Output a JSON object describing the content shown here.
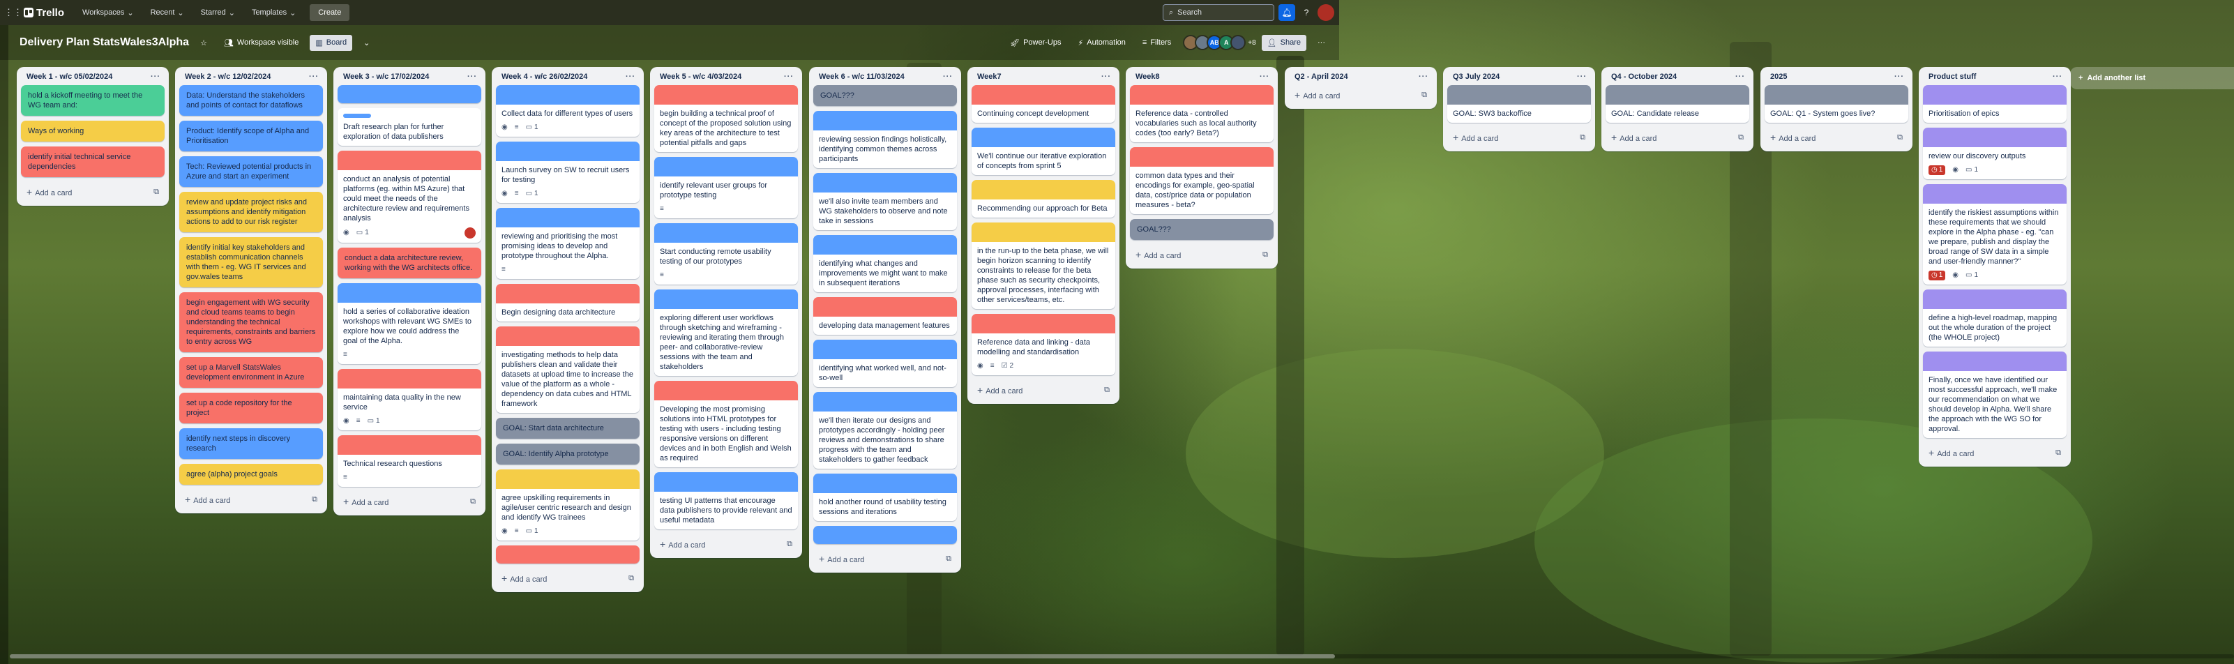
{
  "colors": {
    "red": "#f87168",
    "yellow": "#f5cd47",
    "green": "#4bce97",
    "blue": "#579dff",
    "gray": "#8590a2",
    "purple": "#9f8fef",
    "lightblue": "#cce0ff"
  },
  "topnav": {
    "logo": "Trello",
    "workspaces": "Workspaces",
    "recent": "Recent",
    "starred": "Starred",
    "templates": "Templates",
    "create": "Create",
    "search_placeholder": "Search"
  },
  "board": {
    "title": "Delivery Plan StatsWales3Alpha",
    "visibility": "Workspace visible",
    "view": "Board",
    "powerups": "Power-Ups",
    "automation": "Automation",
    "filters": "Filters",
    "member_count": "+8",
    "share": "Share",
    "avatars": [
      "AB",
      "A"
    ]
  },
  "add_card": "Add a card",
  "add_list": "Add another list",
  "lists": [
    {
      "title": "Week 1 - w/c 05/02/2024",
      "cards": [
        {
          "color": "green",
          "text": "hold a kickoff meeting to meet the WG team and:"
        },
        {
          "color": "yellow",
          "text": "Ways of working"
        },
        {
          "color": "red",
          "text": "identify initial technical service dependencies"
        }
      ]
    },
    {
      "title": "Week 2 - w/c 12/02/2024",
      "cards": [
        {
          "color": "blue",
          "text": "Data: Understand the stakeholders and points of contact for dataflows"
        },
        {
          "color": "blue",
          "text": "Product: Identify scope of Alpha and Prioritisation"
        },
        {
          "color": "blue",
          "text": "Tech: Reviewed potential products in Azure and start an experiment"
        },
        {
          "color": "yellow",
          "text": "review and update project risks and assumptions and identify mitigation actions to add to our risk register"
        },
        {
          "color": "yellow",
          "text": "identify initial key stakeholders and establish communication channels with them - eg. WG IT services and gov.wales teams"
        },
        {
          "color": "red",
          "text": "begin engagement with WG security and cloud teams teams to begin understanding the technical requirements, constraints and barriers to entry across WG"
        },
        {
          "color": "red",
          "text": "set up a Marvell StatsWales development environment in Azure"
        },
        {
          "color": "red",
          "text": "set up a code repository for the project"
        },
        {
          "color": "blue",
          "text": "identify next steps in discovery research"
        },
        {
          "color": "yellow",
          "text": "agree (alpha) project goals"
        }
      ]
    },
    {
      "title": "Week 3 - w/c 17/02/2024",
      "cards": [
        {
          "cover": "blue",
          "text": ""
        },
        {
          "label": "blue",
          "text": "Draft research plan for further exploration of data publishers"
        },
        {
          "cover": "red",
          "text": "conduct an analysis of potential platforms (eg. within MS Azure) that could meet the needs of the architecture review and requirements analysis",
          "watch": true,
          "comments": "1",
          "avatar": true
        },
        {
          "color": "red",
          "text": "conduct a data architecture review, working with the WG architects office."
        },
        {
          "cover": "blue",
          "text": "hold a series of collaborative ideation workshops with relevant WG SMEs to explore how we could address the goal of the Alpha.",
          "desc": true
        },
        {
          "cover": "red",
          "text": "maintaining data quality in the new service",
          "watch": true,
          "desc": true,
          "comments": "1"
        },
        {
          "cover": "red",
          "text": "Technical research questions",
          "desc": true
        }
      ]
    },
    {
      "title": "Week 4 - w/c 26/02/2024",
      "cards": [
        {
          "cover": "blue",
          "text": "Collect data for different types of users",
          "watch": true,
          "desc": true,
          "comments": "1"
        },
        {
          "cover": "blue",
          "text": "Launch survey on SW to recruit users for testing",
          "watch": true,
          "desc": true,
          "comments": "1"
        },
        {
          "cover": "blue",
          "text": "reviewing and prioritising the most promising ideas to develop and prototype throughout the Alpha.",
          "desc": true
        },
        {
          "cover": "red",
          "text": "Begin designing data architecture"
        },
        {
          "cover": "red",
          "text": "investigating methods to help data publishers clean and validate their datasets at upload time to increase the value of the platform as a whole - dependency on data cubes and HTML framework"
        },
        {
          "color": "gray",
          "text": "GOAL: Start data architecture"
        },
        {
          "color": "gray",
          "text": "GOAL: Identify Alpha prototype"
        },
        {
          "cover": "yellow",
          "text": "agree upskilling requirements in agile/user centric research and design and identify WG trainees",
          "watch": true,
          "desc": true,
          "comments": "1"
        },
        {
          "cover": "red",
          "text": ""
        }
      ]
    },
    {
      "title": "Week 5 - w/c 4/03/2024",
      "cards": [
        {
          "cover": "red",
          "text": "begin building a technical proof of concept of the proposed solution using key areas of the architecture to test potential pitfalls and gaps"
        },
        {
          "cover": "blue",
          "text": "identify relevant user groups for prototype testing",
          "desc": true
        },
        {
          "cover": "blue",
          "text": "Start conducting remote usability testing of our prototypes",
          "desc": true
        },
        {
          "cover": "blue",
          "text": "exploring different user workflows through sketching and wireframing - reviewing and iterating them through peer- and collaborative-review sessions with the team and stakeholders"
        },
        {
          "cover": "red",
          "text": "Developing the most promising solutions into HTML prototypes for testing with users - including testing responsive versions on different devices and in both English and Welsh as required"
        },
        {
          "cover": "blue",
          "text": "testing UI patterns that encourage data publishers to provide relevant and useful metadata"
        }
      ]
    },
    {
      "title": "Week 6 - w/c 11/03/2024",
      "cards": [
        {
          "color": "gray",
          "text": "GOAL???"
        },
        {
          "cover": "blue",
          "text": "reviewing session findings holistically, identifying common themes across participants"
        },
        {
          "cover": "blue",
          "text": "we'll also invite team members and WG stakeholders to observe and note take in sessions"
        },
        {
          "cover": "blue",
          "text": "identifying what changes and improvements we might want to make in subsequent iterations"
        },
        {
          "cover": "red",
          "text": "developing data management features"
        },
        {
          "cover": "blue",
          "text": "identifying what worked well, and not-so-well"
        },
        {
          "cover": "blue",
          "text": "we'll then iterate our designs and prototypes accordingly - holding peer reviews and demonstrations to share progress with the team and stakeholders to gather feedback"
        },
        {
          "cover": "blue",
          "text": "hold another round of usability testing sessions and iterations"
        },
        {
          "cover": "blue",
          "text": ""
        }
      ]
    },
    {
      "title": "Week7",
      "cards": [
        {
          "cover": "red",
          "text": "Continuing concept development"
        },
        {
          "cover": "blue",
          "text": "We'll continue our iterative exploration of concepts from sprint 5"
        },
        {
          "cover": "yellow",
          "text": "Recommending our approach for Beta"
        },
        {
          "cover": "yellow",
          "text": "in the run-up to the beta phase, we will begin horizon scanning to identify constraints to release for the beta phase such as security checkpoints, approval processes, interfacing with other services/teams, etc."
        },
        {
          "cover": "red",
          "text": "Reference data and linking - data modelling and standardisation",
          "watch": true,
          "desc": true,
          "checklist": "2"
        }
      ]
    },
    {
      "title": "Week8",
      "cards": [
        {
          "cover": "red",
          "text": "Reference data - controlled vocabularies such as local authority codes (too early? Beta?)"
        },
        {
          "cover": "red",
          "text": "common data types and their encodings for example, geo-spatial data, cost/price data or population measures - beta?"
        },
        {
          "color": "gray",
          "text": "GOAL???"
        }
      ]
    },
    {
      "title": "Q2 - April 2024",
      "cards": []
    },
    {
      "title": "Q3 July 2024",
      "cards": [
        {
          "cover": "gray",
          "text": "GOAL: SW3 backoffice"
        }
      ]
    },
    {
      "title": "Q4 - October 2024",
      "cards": [
        {
          "cover": "gray",
          "text": "GOAL: Candidate release"
        }
      ]
    },
    {
      "title": "2025",
      "cards": [
        {
          "cover": "gray",
          "text": "GOAL: Q1 - System goes live?"
        }
      ]
    },
    {
      "title": "Product stuff",
      "cards": [
        {
          "cover": "purple",
          "text": "Prioritisation of epics"
        },
        {
          "cover": "purple",
          "text": "review our discovery outputs",
          "badge": "1",
          "watch": true,
          "comments": "1"
        },
        {
          "cover": "purple",
          "text": "identify the riskiest assumptions within these requirements that we should explore in the Alpha phase - eg. \"can we prepare, publish and display the broad range of SW data in a simple and user-friendly manner?\"",
          "badge": "1",
          "watch": true,
          "comments": "1"
        },
        {
          "cover": "purple",
          "text": "define a high-level roadmap, mapping out the whole duration of the project (the WHOLE project)"
        },
        {
          "cover": "purple",
          "text": "Finally, once we have identified our most successful approach, we'll make our recommendation on what we should develop in Alpha. We'll share the approach with the WG SO for approval."
        }
      ]
    }
  ]
}
